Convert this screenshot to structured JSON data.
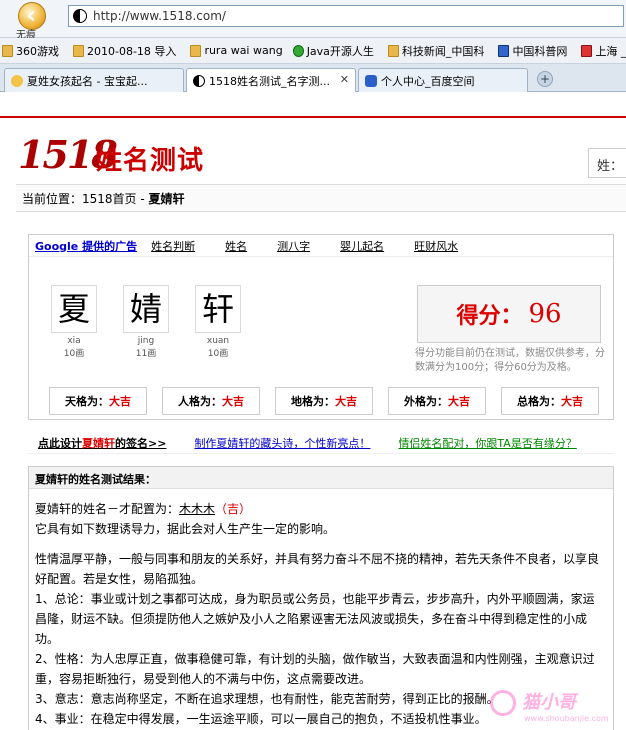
{
  "browser": {
    "undo_label": "无痕",
    "url": "http://www.1518.com/",
    "bookmarks": [
      "360游戏",
      "2010-08-18 导入",
      "rura wai wang",
      "Java开源人生",
      "科技新闻_中国科",
      "中国科普网",
      "上海 _ 新彭"
    ],
    "tabs": [
      {
        "label": "夏姓女孩起名 - 宝宝起..."
      },
      {
        "label": "1518姓名测试_名字测..."
      },
      {
        "label": "个人中心_百度空间"
      }
    ],
    "new_tab_icon": "plus-icon"
  },
  "site": {
    "logo_number": "1518",
    "logo_text": "姓名测试",
    "search_partial": "姓：",
    "breadcrumb_prefix": "当前位置：1518首页 - ",
    "breadcrumb_name": "夏婧轩",
    "nav_ads_google": "Google",
    "nav_ads_suffix": " 提供的广告",
    "nav_links": [
      "姓名判断",
      "姓名",
      "测八字",
      "婴儿起名",
      "旺财风水"
    ],
    "chars": [
      {
        "char": "夏",
        "pinyin": "xia",
        "strokes": "10画"
      },
      {
        "char": "婧",
        "pinyin": "jing",
        "strokes": "11画"
      },
      {
        "char": "轩",
        "pinyin": "xuan",
        "strokes": "10画"
      }
    ],
    "score_label": "得分：",
    "score_value": "96",
    "score_note": "得分功能目前仍在测试，数据仅供参考，分数满分为100分；得分60分为及格。",
    "ge": [
      {
        "label": "天格为：",
        "value": "大吉"
      },
      {
        "label": "人格为：",
        "value": "大吉"
      },
      {
        "label": "地格为：",
        "value": "大吉"
      },
      {
        "label": "外格为：",
        "value": "大吉"
      },
      {
        "label": "总格为：",
        "value": "大吉"
      }
    ],
    "link1_prefix": "点此设计",
    "link1_name": "夏婧轩",
    "link1_suffix": "的签名>>",
    "link2": "制作夏婧轩的藏头诗，个性新亮点！",
    "link3": "情侣姓名配对，你跟TA是否有缘分？",
    "result_title": "夏婧轩的姓名测试结果：",
    "line1_prefix": "夏婧轩的姓名－才配置为：",
    "line1_config": "木木木",
    "line1_luck": "（吉）",
    "line2": "它具有如下数理诱导力，据此会对人生产生一定的影响。",
    "para1": "性情温厚平静，一般与同事和朋友的关系好，并具有努力奋斗不屈不挠的精神，若先天条件不良者，以享良好配置。若是女性，易陷孤独。",
    "para2": "1、总论：事业或计划之事都可达成，身为职员或公务员，也能平步青云，步步高升，内外平顺圆满，家运昌隆，财运不缺。但须提防他人之嫉妒及小人之陷累诬害无法风波或损失，多在奋斗中得到稳定性的小成功。",
    "para3": "2、性格：为人忠厚正直，做事稳健可靠，有计划的头脑，做作敏当，大致表面温和内性刚强，主观意识过重，容易拒断独行，易受到他人的不满与中伤，这点需要改进。",
    "para4": "3、意志：意志尚称坚定，不断在追求理想，也有耐性，能克苦耐劳，得到正比的报酬。",
    "para5": "4、事业：在稳定中得发展，一生运途平顺，可以一展自己的抱负，不适投机性事业。",
    "watermark": "猫小哥",
    "watermark_sub": "www.shoubanjie.com"
  }
}
